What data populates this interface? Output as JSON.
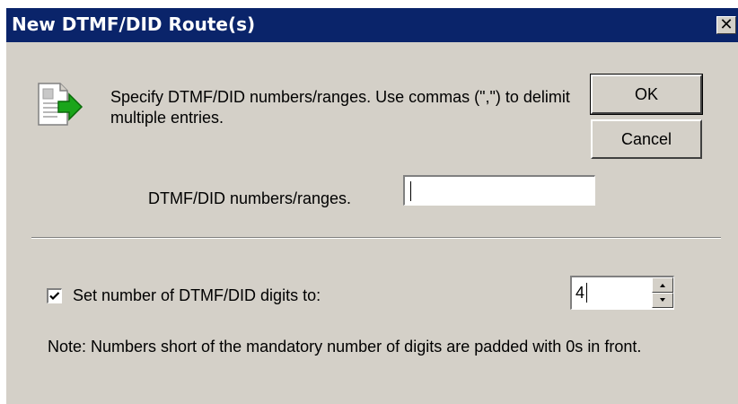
{
  "window": {
    "title": "New DTMF/DID Route(s)",
    "close_glyph": "✕"
  },
  "instructions": "Specify DTMF/DID numbers/ranges. Use commas (\",\") to delimit multiple entries.",
  "buttons": {
    "ok": "OK",
    "cancel": "Cancel"
  },
  "numbers_field": {
    "label": "DTMF/DID numbers/ranges.",
    "value": ""
  },
  "digits": {
    "checkbox_checked": true,
    "label": "Set number of DTMF/DID digits to:",
    "value": "4"
  },
  "note": "Note: Numbers short of the mandatory number of digits are padded with 0s in front.",
  "colors": {
    "titlebar": "#0a246a",
    "dialog_bg": "#d4d0c8",
    "arrow_green": "#1aa51a"
  },
  "icons": {
    "wizard": "document-arrow-icon",
    "close": "close-icon",
    "check": "checkmark-icon",
    "spin_up": "spin-up-arrow-icon",
    "spin_down": "spin-down-arrow-icon"
  }
}
